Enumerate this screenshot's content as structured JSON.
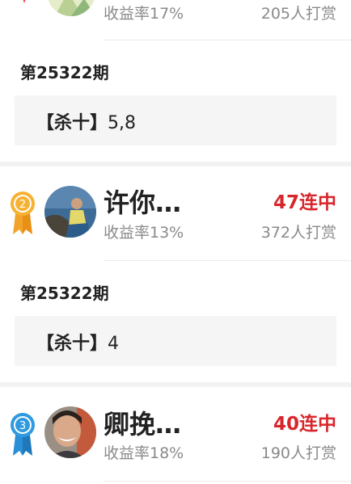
{
  "colors": {
    "streak": "#d8262c",
    "muted": "#8a8a8a",
    "box": "#f5f5f5",
    "medal_silver_ribbon": "#f2a32b",
    "medal_bronze_ribbon": "#2a8fd6"
  },
  "top_card": {
    "rate": "收益率17%",
    "tips": "205人打赏"
  },
  "entries": [
    {
      "issue": "第25322期",
      "pick_tag": "【杀十】",
      "pick_value": "5,8"
    },
    {
      "rank": "2",
      "medal_icon": "medal-2-icon",
      "name": "许你…",
      "streak": "47连中",
      "rate": "收益率13%",
      "tips": "372人打赏",
      "issue": "第25322期",
      "pick_tag": "【杀十】",
      "pick_value": "4"
    },
    {
      "rank": "3",
      "medal_icon": "medal-3-icon",
      "name": "卿挽…",
      "streak": "40连中",
      "rate": "收益率18%",
      "tips": "190人打赏"
    }
  ]
}
